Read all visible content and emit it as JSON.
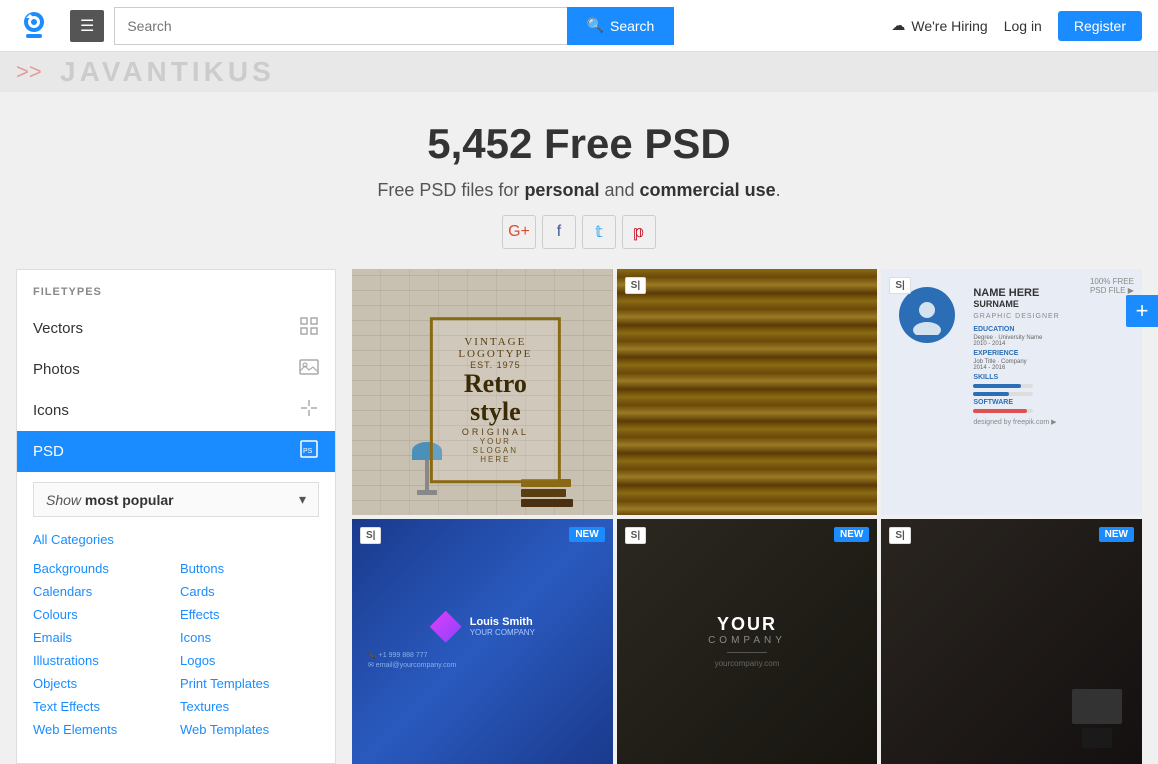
{
  "header": {
    "logo_alt": "Freepik",
    "hamburger_label": "☰",
    "search_placeholder": "Search",
    "search_button_label": "Search",
    "search_icon": "🔍",
    "hiring_label": "We're Hiring",
    "hiring_icon": "☁",
    "login_label": "Log in",
    "register_label": "Register"
  },
  "watermark": {
    "text": "JAVANTIKUS",
    "arrows": ">>"
  },
  "hero": {
    "title": "5,452 Free PSD",
    "subtitle_prefix": "Free PSD files for ",
    "personal": "personal",
    "and": " and ",
    "commercial": "commercial use",
    "period": ".",
    "social": {
      "google": "G+",
      "facebook": "f",
      "twitter": "t",
      "pinterest": "p"
    }
  },
  "sidebar": {
    "filetypes_label": "FILETYPES",
    "items": [
      {
        "label": "Vectors",
        "icon": "⊞"
      },
      {
        "label": "Photos",
        "icon": "🖼"
      },
      {
        "label": "Icons",
        "icon": "✦"
      },
      {
        "label": "PSD",
        "icon": "⊡"
      }
    ],
    "show_popular": {
      "prefix": "Show ",
      "keyword": "most popular",
      "chevron": "▾"
    },
    "all_categories_label": "All Categories",
    "categories_col1": [
      "Backgrounds",
      "Calendars",
      "Colours",
      "Emails",
      "Illustrations",
      "Objects",
      "Text Effects",
      "Web Elements"
    ],
    "categories_col2": [
      "Buttons",
      "Cards",
      "Effects",
      "Icons",
      "Logos",
      "Print Templates",
      "Textures",
      "Web Templates"
    ]
  },
  "images": {
    "badge_new": "NEW",
    "s_badge": "S",
    "cards": [
      {
        "id": 1,
        "type": "retro-poster",
        "label": "Retro style poster PSD"
      },
      {
        "id": 2,
        "type": "wood-bg",
        "label": "Wood background PSD"
      },
      {
        "id": 3,
        "type": "resume",
        "label": "Resume CV PSD",
        "name": "NAME HERE",
        "surname": "SURNAME"
      },
      {
        "id": 4,
        "type": "business-card-blue",
        "label": "Blue business card PSD",
        "new": true
      },
      {
        "id": 5,
        "type": "business-card-dark",
        "label": "Dark business card PSD",
        "new": true
      },
      {
        "id": 6,
        "type": "desk-dark",
        "label": "Dark desk PSD",
        "new": true
      }
    ]
  },
  "plus_button": {
    "label": "+"
  }
}
